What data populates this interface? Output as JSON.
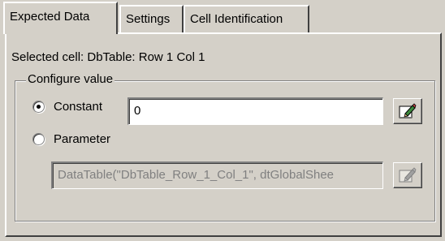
{
  "tabs": [
    {
      "label": "Expected Data",
      "active": true
    },
    {
      "label": "Settings",
      "active": false
    },
    {
      "label": "Cell Identification",
      "active": false
    }
  ],
  "selected_cell_text": "Selected cell: DbTable: Row 1 Col 1",
  "configure_group": {
    "legend": "Configure value",
    "constant": {
      "label": "Constant",
      "checked": true,
      "value": "0",
      "edit_icon": "pencil-edit-icon"
    },
    "parameter": {
      "label": "Parameter",
      "checked": false,
      "value": "DataTable(\"DbTable_Row_1_Col_1\", dtGlobalShee",
      "edit_icon": "pencil-edit-icon",
      "disabled": true
    }
  },
  "colors": {
    "face": "#d4d0c8",
    "pencil": "#3c8a3c"
  }
}
